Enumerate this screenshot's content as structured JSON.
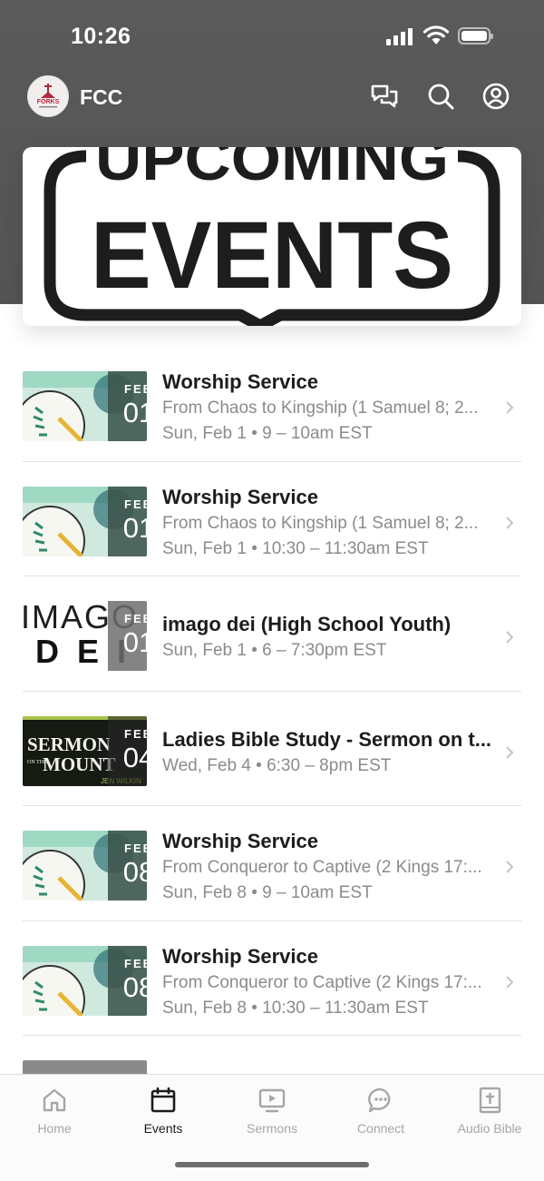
{
  "status_bar": {
    "time": "10:26"
  },
  "header": {
    "title": "FCC",
    "logo_text": "FORKS"
  },
  "banner": {
    "line1": "UPCOMING",
    "line2": "EVENTS"
  },
  "events": [
    {
      "title": "Worship Service",
      "subtitle": "From Chaos to Kingship (1 Samuel 8; 2...",
      "datetime": "Sun, Feb 1 • 9 – 10am EST",
      "month": "FEB",
      "day": "01",
      "thumb": "new-chapter"
    },
    {
      "title": "Worship Service",
      "subtitle": "From Chaos to Kingship (1 Samuel 8; 2...",
      "datetime": "Sun, Feb 1 • 10:30 – 11:30am EST",
      "month": "FEB",
      "day": "01",
      "thumb": "new-chapter"
    },
    {
      "title": "imago dei (High School Youth)",
      "subtitle": "",
      "datetime": "Sun, Feb 1 • 6 – 7:30pm EST",
      "month": "FEB",
      "day": "01",
      "thumb": "imago-dei",
      "thumb_text_1": "IMAGO",
      "thumb_text_2": "DEI"
    },
    {
      "title": "Ladies Bible Study - Sermon on t...",
      "subtitle": "",
      "datetime": "Wed, Feb 4 • 6:30 – 8pm EST",
      "month": "FEB",
      "day": "04",
      "thumb": "sermon-mount",
      "thumb_text_1": "SERMON",
      "thumb_text_2": "ON THE",
      "thumb_text_3": "MOUNT",
      "thumb_text_4": "JEN WILKIN"
    },
    {
      "title": "Worship Service",
      "subtitle": "From Conqueror to Captive (2 Kings 17:...",
      "datetime": "Sun, Feb 8 • 9 – 10am EST",
      "month": "FEB",
      "day": "08",
      "thumb": "new-chapter"
    },
    {
      "title": "Worship Service",
      "subtitle": "From Conqueror to Captive (2 Kings 17:...",
      "datetime": "Sun, Feb 8 • 10:30 – 11:30am EST",
      "month": "FEB",
      "day": "08",
      "thumb": "new-chapter"
    }
  ],
  "tabs": [
    {
      "label": "Home",
      "icon": "home-icon",
      "active": false
    },
    {
      "label": "Events",
      "icon": "calendar-icon",
      "active": true
    },
    {
      "label": "Sermons",
      "icon": "video-icon",
      "active": false
    },
    {
      "label": "Connect",
      "icon": "chat-bubble-icon",
      "active": false
    },
    {
      "label": "Audio Bible",
      "icon": "bible-icon",
      "active": false
    }
  ],
  "colors": {
    "header_bg": "#575757",
    "badge_green": "#3c544c",
    "inactive_tab": "#a6a6aa",
    "active_tab": "#1c1c1e"
  }
}
